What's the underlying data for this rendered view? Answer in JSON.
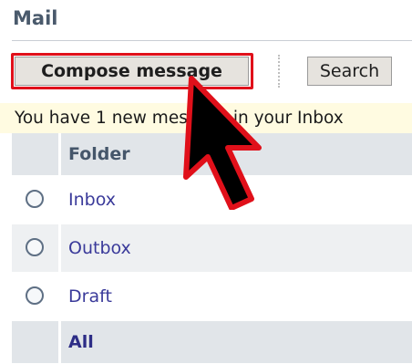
{
  "app": {
    "title": "Mail"
  },
  "toolbar": {
    "compose_label": "Compose message",
    "search_label": "Search"
  },
  "notice": {
    "text": "You have 1 new message in your Inbox"
  },
  "folders": {
    "header": "Folder",
    "items": [
      {
        "label": "Inbox",
        "selected": false
      },
      {
        "label": "Outbox",
        "selected": false
      },
      {
        "label": "Draft",
        "selected": false
      }
    ],
    "footer": "All"
  },
  "colors": {
    "highlight": "#e0101a",
    "notice_bg": "#fffbe1",
    "folder_link": "#3a3a9a",
    "header_bg": "#e1e5e9"
  }
}
